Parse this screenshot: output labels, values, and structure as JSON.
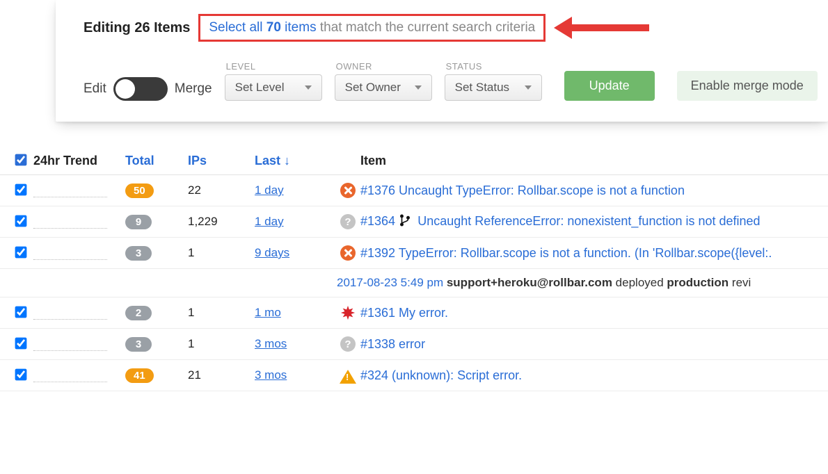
{
  "editing": {
    "title": "Editing 26 Items",
    "select_all_link": "Select all ",
    "select_all_count": "70",
    "select_all_items": " items ",
    "select_all_rest": "that match the current search criteria"
  },
  "controls": {
    "edit_label": "Edit",
    "merge_label": "Merge",
    "level_label": "LEVEL",
    "level_value": "Set Level",
    "owner_label": "OWNER",
    "owner_value": "Set Owner",
    "status_label": "STATUS",
    "status_value": "Set Status",
    "update_label": "Update",
    "enable_merge_label": "Enable merge mode"
  },
  "columns": {
    "trend": "24hr Trend",
    "total": "Total",
    "ips": "IPs",
    "last": "Last ↓",
    "item": "Item"
  },
  "rows": [
    {
      "checked": true,
      "total": "50",
      "total_style": "orange",
      "ips": "22",
      "last": "1 day",
      "icon": "error",
      "item": "#1376 Uncaught TypeError: Rollbar.scope is not a function"
    },
    {
      "checked": true,
      "total": "9",
      "total_style": "gray",
      "ips": "1,229",
      "last": "1 day",
      "icon": "question",
      "branch": true,
      "item_prefix": "#1364",
      "item": "Uncaught ReferenceError: nonexistent_function is not defined"
    },
    {
      "checked": true,
      "total": "3",
      "total_style": "gray",
      "ips": "1",
      "last": "9 days",
      "icon": "error",
      "item": "#1392 TypeError: Rollbar.scope is not a function. (In 'Rollbar.scope({level:."
    }
  ],
  "deploy": {
    "ts": "2017-08-23 5:49 pm",
    "actor": "support+heroku@rollbar.com",
    "verb": " deployed ",
    "env": "production",
    "rest": " revi"
  },
  "rows2": [
    {
      "checked": true,
      "total": "2",
      "total_style": "gray",
      "ips": "1",
      "last": "1 mo",
      "icon": "critical",
      "item": "#1361 My error."
    },
    {
      "checked": true,
      "total": "3",
      "total_style": "gray",
      "ips": "1",
      "last": "3 mos",
      "icon": "question",
      "item": "#1338 error"
    },
    {
      "checked": true,
      "total": "41",
      "total_style": "orange",
      "ips": "21",
      "last": "3 mos",
      "icon": "warn",
      "item": "#324 (unknown): Script error."
    }
  ]
}
